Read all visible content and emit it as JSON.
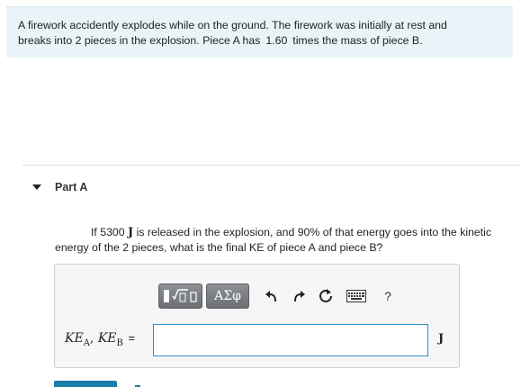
{
  "problem": {
    "line1": "A firework accidently explodes while on the ground. The firework was initially at rest and",
    "line2_prefix": "breaks into 2 pieces in the explosion. Piece A has",
    "mass_ratio": "1.60",
    "line2_suffix": "times the mass of piece B."
  },
  "part": {
    "title": "Part A"
  },
  "question": {
    "prefix": "If 5300",
    "energy_unit": "J",
    "suffix": "is released in the explosion, and 90% of that energy goes into the kinetic energy of the 2 pieces, what is the final KE of piece A and piece B?"
  },
  "toolbar": {
    "symbols_label": "ΑΣφ",
    "help_label": "?",
    "icons": [
      "templates-icon",
      "undo-icon",
      "redo-icon",
      "reset-icon",
      "keyboard-icon",
      "help-icon"
    ]
  },
  "answer": {
    "var1": "KE",
    "sub1": "A",
    "separator": ", ",
    "var2": "KE",
    "sub2": "B",
    "equals": " =",
    "value": "",
    "placeholder": "",
    "unit": "J"
  },
  "colors": {
    "problem_bg": "#e8f4f8",
    "input_border": "#2f8fc7",
    "toolbar_button": "#7a7d81",
    "submit_button": "#1a7ea9"
  }
}
